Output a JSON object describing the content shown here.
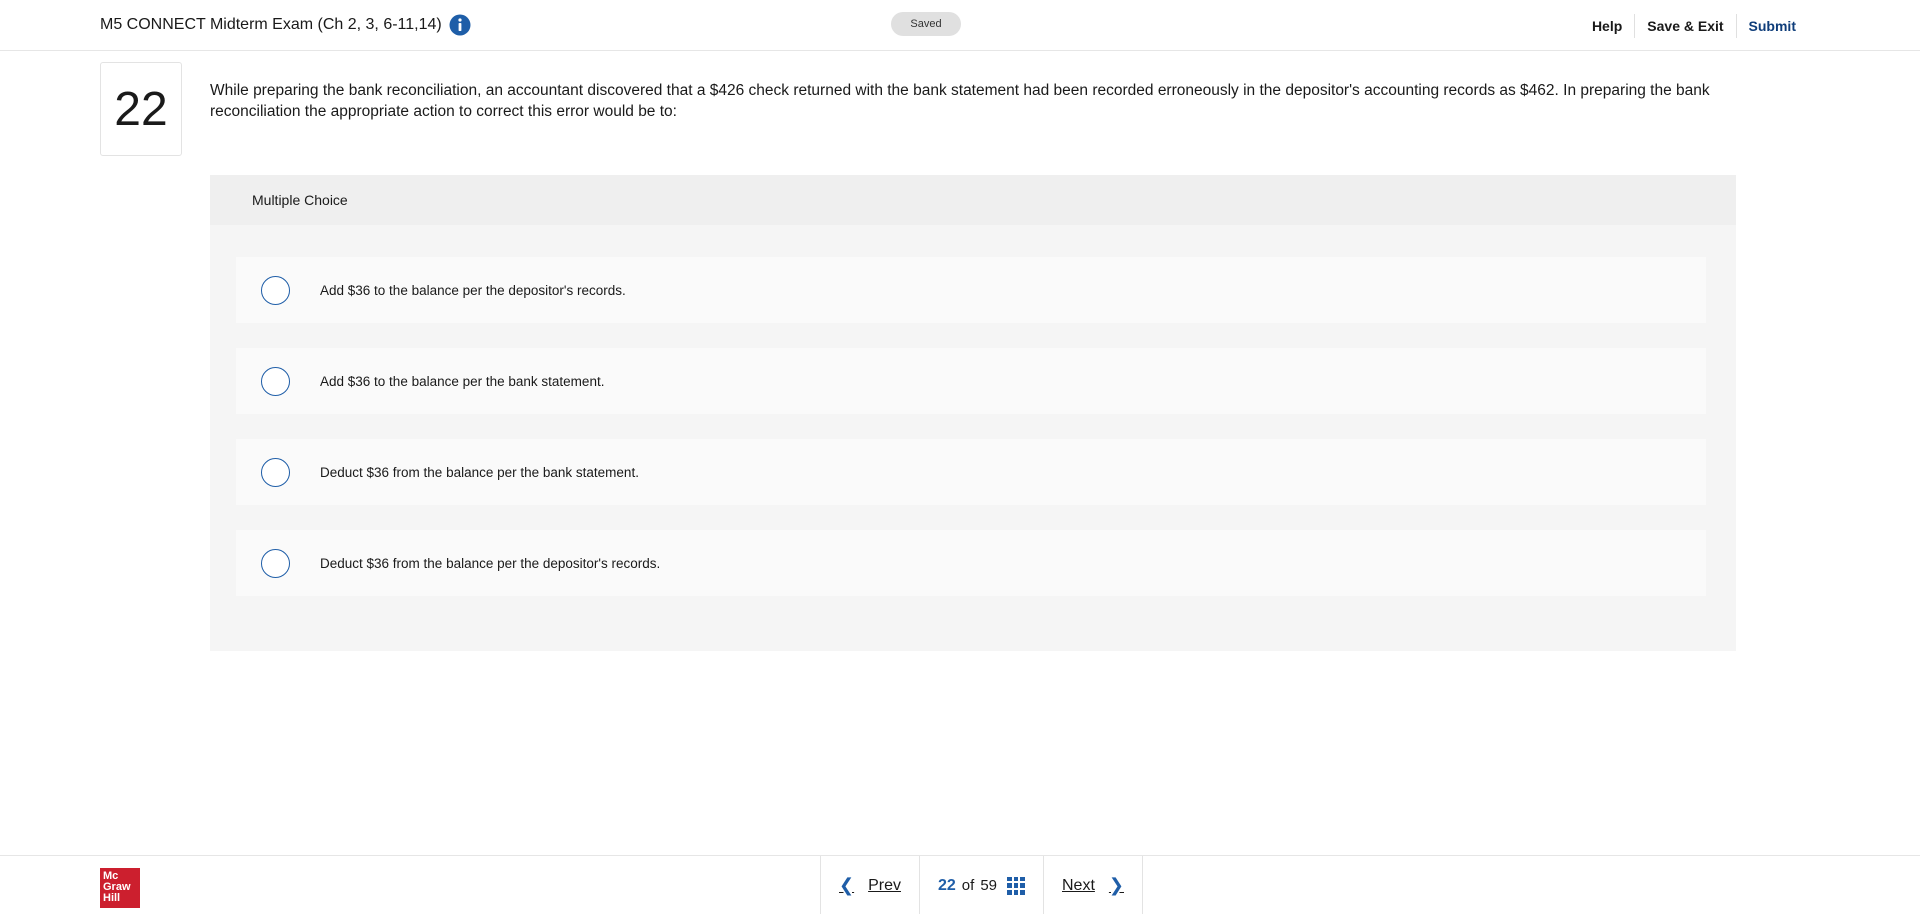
{
  "header": {
    "exam_title": "M5 CONNECT Midterm Exam (Ch 2, 3, 6-11,14)",
    "info_icon": "info-icon",
    "saved_label": "Saved",
    "help_label": "Help",
    "save_exit_label": "Save & Exit",
    "submit_label": "Submit"
  },
  "question": {
    "number": "22",
    "text": "While preparing the bank reconciliation, an accountant discovered that a $426 check returned with the bank statement had been recorded erroneously in the depositor's accounting records as $462. In preparing the bank reconciliation the appropriate action to correct this error would be to:",
    "type_label": "Multiple Choice",
    "options": [
      {
        "label": "Add $36 to the balance per the depositor's records."
      },
      {
        "label": "Add $36 to the balance per the bank statement."
      },
      {
        "label": "Deduct $36 from the balance per the bank statement."
      },
      {
        "label": "Deduct $36 from the balance per the depositor's records."
      }
    ]
  },
  "footer": {
    "logo_text": "Mc Graw Hill",
    "prev_label": "Prev",
    "next_label": "Next",
    "current_page": "22",
    "of_label": "of",
    "total_pages": "59",
    "accent_color": "#1f5ea8",
    "brand_color": "#cc1f2e"
  }
}
